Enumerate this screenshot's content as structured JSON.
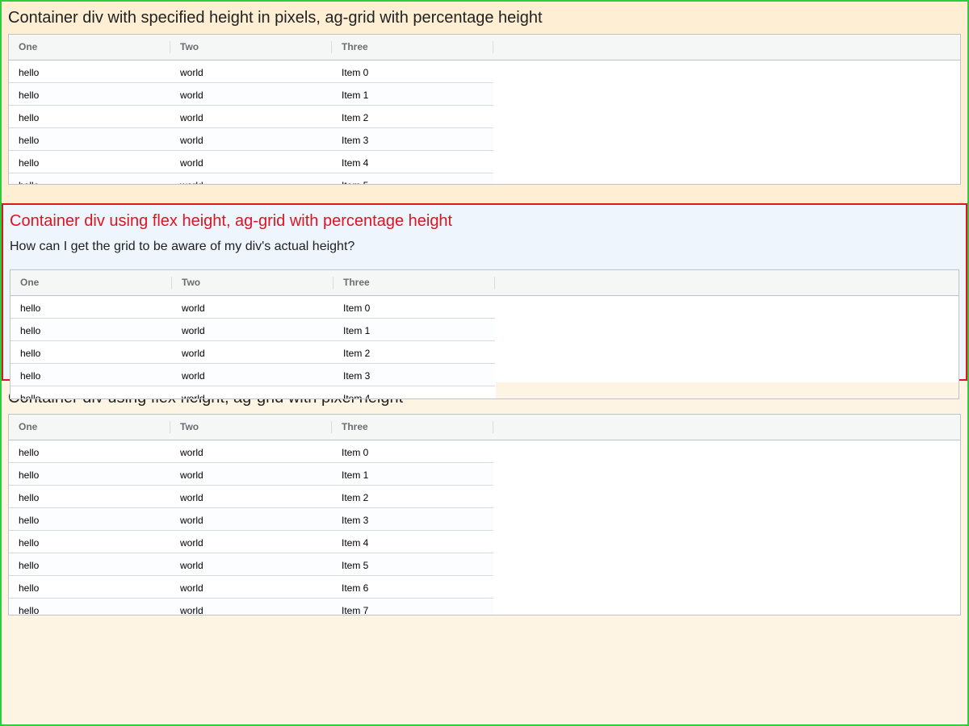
{
  "sections": [
    {
      "heading": "Container div with specified height in pixels, ag-grid with percentage height"
    },
    {
      "heading": "Container div using flex height, ag-grid with percentage height",
      "question": "How can I get the grid to be aware of my div's actual height?"
    },
    {
      "heading": "Container div using flex height, ag-grid with pixel height"
    }
  ],
  "grid": {
    "columns": [
      "One",
      "Two",
      "Three"
    ],
    "rows": [
      [
        "hello",
        "world",
        "Item 0"
      ],
      [
        "hello",
        "world",
        "Item 1"
      ],
      [
        "hello",
        "world",
        "Item 2"
      ],
      [
        "hello",
        "world",
        "Item 3"
      ],
      [
        "hello",
        "world",
        "Item 4"
      ],
      [
        "hello",
        "world",
        "Item 5"
      ],
      [
        "hello",
        "world",
        "Item 6"
      ],
      [
        "hello",
        "world",
        "Item 7"
      ]
    ]
  },
  "colors": {
    "frame_border": "#2ecc40",
    "highlight_border": "#e0141e",
    "highlight_background": "#eef5fd",
    "section_background": "#fdeed4"
  }
}
